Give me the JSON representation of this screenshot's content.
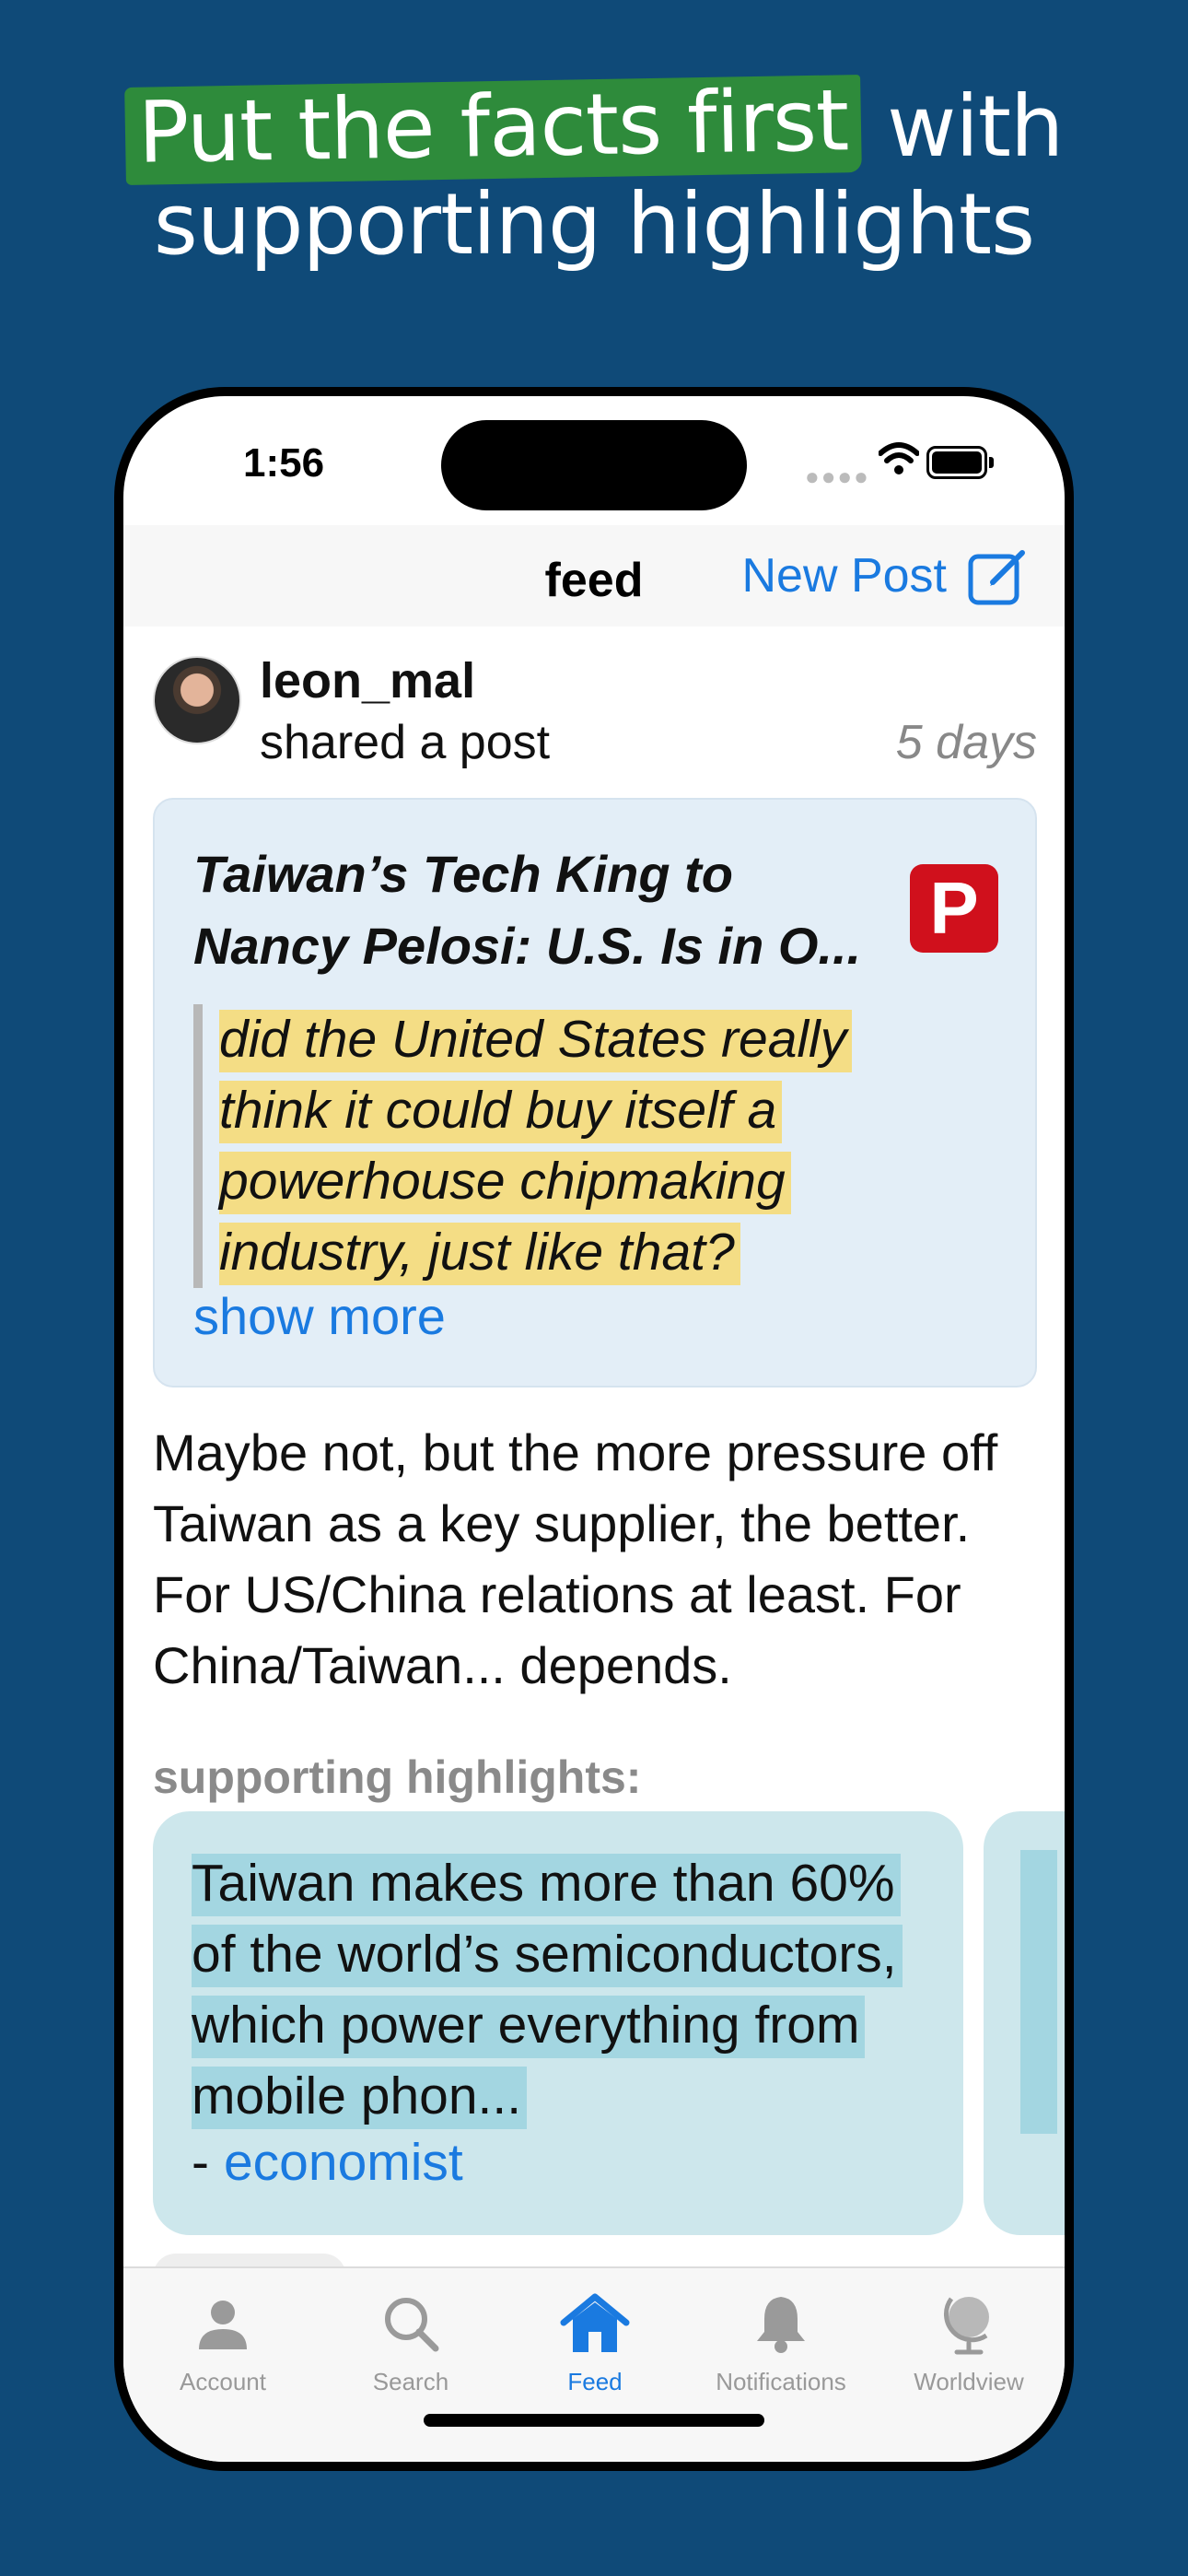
{
  "marketing": {
    "headline_highlight": "Put the facts first",
    "headline_rest": " with",
    "headline_line2": "supporting highlights"
  },
  "status_bar": {
    "time": "1:56"
  },
  "nav": {
    "title": "feed",
    "new_post_label": "New Post"
  },
  "post": {
    "username": "leon_mal",
    "action": "shared a post",
    "time_ago": "5 days",
    "article": {
      "title": "Taiwan’s Tech King to Nancy Pelosi: U.S. Is in O...",
      "source_letter": "P",
      "quote": "did the United States really think it could buy itself a powerhouse chipmaking industry, just like that?",
      "show_more": "show more"
    },
    "comment": "Maybe not, but the more pressure off Taiwan as a key supplier, the better. For US/China relations at least. For China/Taiwan... depends.",
    "supporting_label": "supporting highlights:",
    "highlights": [
      {
        "text": "Taiwan makes more than 60% of the world’s semiconductors, which power everything from mobile phon...",
        "dash": "-",
        "source": "economist"
      }
    ]
  },
  "tabbar": {
    "tabs": [
      {
        "label": "Account",
        "icon": "person-icon",
        "active": false
      },
      {
        "label": "Search",
        "icon": "search-icon",
        "active": false
      },
      {
        "label": "Feed",
        "icon": "home-icon",
        "active": true
      },
      {
        "label": "Notifications",
        "icon": "bell-icon",
        "active": false
      },
      {
        "label": "Worldview",
        "icon": "globe-icon",
        "active": false
      }
    ]
  },
  "colors": {
    "background": "#0f4a78",
    "headline_highlight": "#2e8b3b",
    "accent": "#1a7ae0",
    "quote_highlight": "#f4dd85",
    "supporting_highlight": "#a3d6e1",
    "source_icon": "#d0101c"
  }
}
